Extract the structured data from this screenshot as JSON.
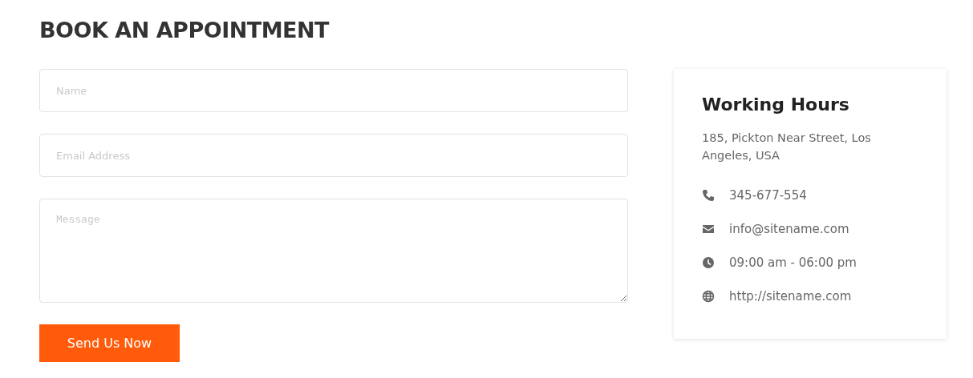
{
  "heading": "BOOK AN APPOINTMENT",
  "form": {
    "fields": [
      {
        "kind": "text",
        "placeholder": "Name"
      },
      {
        "kind": "text",
        "placeholder": "Email Address"
      },
      {
        "kind": "textarea",
        "placeholder": "Message"
      }
    ],
    "submit": "Send Us Now"
  },
  "card": {
    "title": "Working Hours",
    "address": "185, Pickton Near Street, Los Angeles, USA",
    "items": [
      {
        "kind": "phone",
        "text": "345-677-554"
      },
      {
        "kind": "email",
        "text": "info@sitename.com"
      },
      {
        "kind": "clock",
        "text": "09:00 am - 06:00 pm"
      },
      {
        "kind": "web",
        "text": "http://sitename.com"
      }
    ]
  }
}
